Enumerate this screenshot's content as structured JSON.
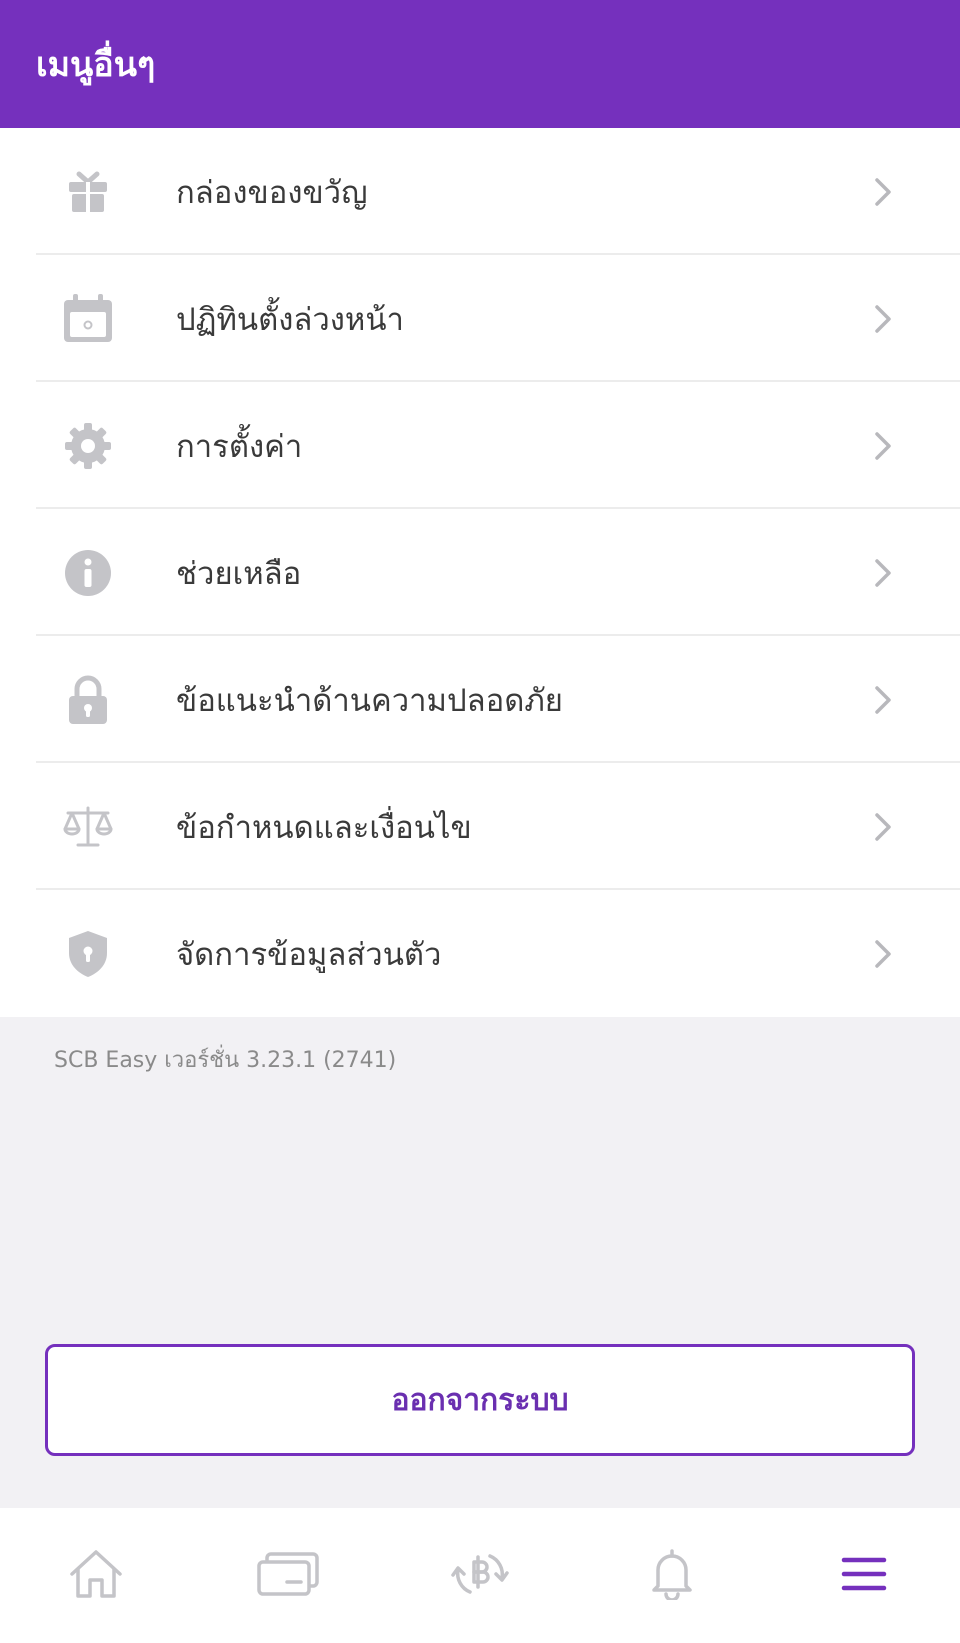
{
  "header": {
    "title": "เมนูอื่นๆ"
  },
  "menu": {
    "items": [
      {
        "label": "กล่องของขวัญ",
        "icon": "gift-icon"
      },
      {
        "label": "ปฏิทินตั้งล่วงหน้า",
        "icon": "calendar-icon"
      },
      {
        "label": "การตั้งค่า",
        "icon": "gear-icon"
      },
      {
        "label": "ช่วยเหลือ",
        "icon": "info-icon"
      },
      {
        "label": "ข้อแนะนำด้านความปลอดภัย",
        "icon": "lock-icon"
      },
      {
        "label": "ข้อกำหนดและเงื่อนไข",
        "icon": "scale-icon"
      },
      {
        "label": "จัดการข้อมูลส่วนตัว",
        "icon": "shield-icon"
      }
    ]
  },
  "version_text": "SCB Easy เวอร์ชั่น 3.23.1 (2741)",
  "logout": {
    "label": "ออกจากระบบ"
  },
  "tabbar": {
    "tabs": [
      {
        "icon": "home-icon",
        "active": false
      },
      {
        "icon": "card-icon",
        "active": false
      },
      {
        "icon": "baht-transfer-icon",
        "active": false
      },
      {
        "icon": "bell-icon",
        "active": false
      },
      {
        "icon": "menu-icon",
        "active": true
      }
    ]
  },
  "colors": {
    "brand": "#7530bd",
    "icon_gray": "#c4c4c8",
    "background": "#f2f1f4"
  }
}
